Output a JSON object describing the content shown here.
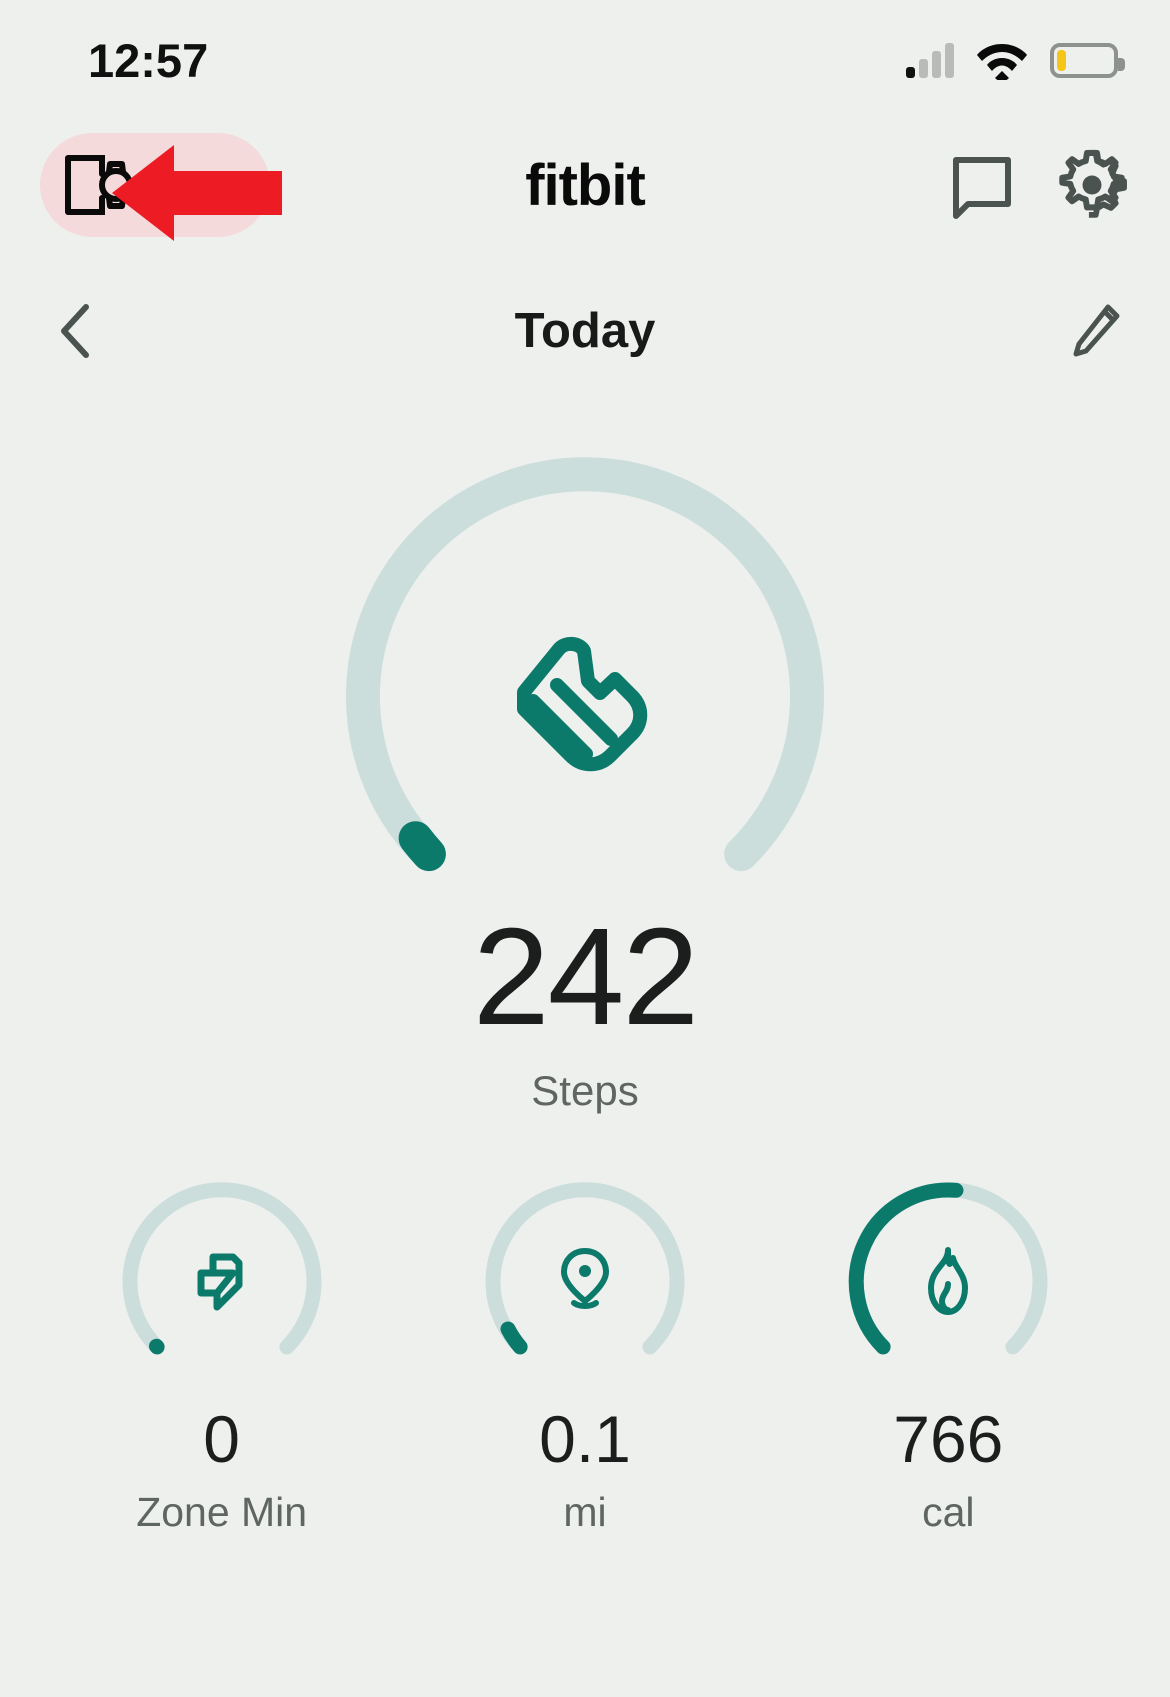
{
  "status_bar": {
    "time": "12:57",
    "signal_icon": "cellular-signal-icon",
    "signal_bars_total": 4,
    "signal_bars_active": 1,
    "wifi_icon": "wifi-icon",
    "battery_icon": "battery-low-icon",
    "battery_percent": 16,
    "battery_fill_color": "#f5c518"
  },
  "app_bar": {
    "device_button_icon": "phone-watch-device-icon",
    "device_button_highlight_color": "#f4dada",
    "brand": "fitbit",
    "chat_icon": "chat-bubble-icon",
    "settings_icon": "gear-icon",
    "annotation_arrow": "red-left-arrow",
    "annotation_color": "#ed1c24"
  },
  "date_bar": {
    "back_icon": "chevron-left-icon",
    "title": "Today",
    "edit_icon": "pencil-edit-icon"
  },
  "main_metric": {
    "icon": "running-shoe-icon",
    "value": "242",
    "label": "Steps",
    "progress": 0.04,
    "track_color": "#ccdedb",
    "progress_color": "#0b7a6b"
  },
  "metrics": [
    {
      "icon": "zone-minutes-arrow-icon",
      "value": "0",
      "label": "Zone Min",
      "progress": 0.005,
      "track_color": "#ccdedb",
      "progress_color": "#0b7a6b"
    },
    {
      "icon": "location-pin-icon",
      "value": "0.1",
      "label": "mi",
      "progress": 0.055,
      "track_color": "#ccdedb",
      "progress_color": "#0b7a6b"
    },
    {
      "icon": "flame-icon",
      "value": "766",
      "label": "cal",
      "progress": 0.58,
      "track_color": "#ccdedb",
      "progress_color": "#0b7a6b"
    }
  ],
  "theme": {
    "background": "#eef0ee",
    "accent_teal": "#0b7a6b",
    "muted_text": "#5f6562",
    "icon_gray": "#4b5350"
  }
}
